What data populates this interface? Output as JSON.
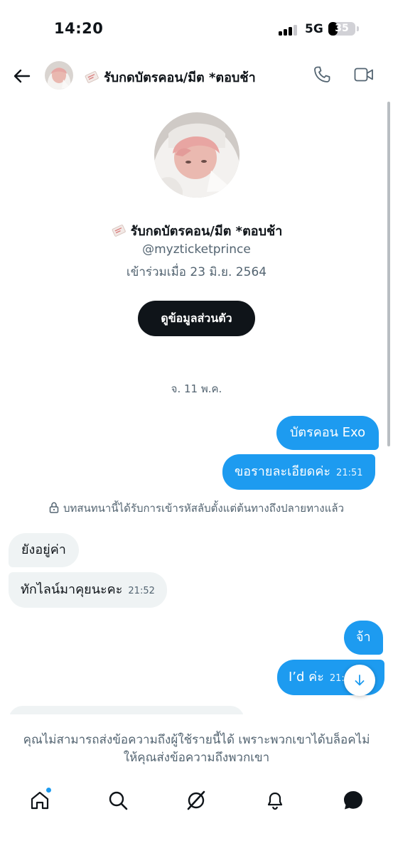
{
  "status_bar": {
    "time": "14:20",
    "network": "5G",
    "battery_percent": "35"
  },
  "header": {
    "title": "รับกดบัตรคอน/มีต *ตอบช้า"
  },
  "profile": {
    "name": "รับกดบัตรคอน/มีต *ตอบช้า",
    "handle": "@myzticketprince",
    "joined": "เข้าร่วมเมื่อ 23 มิ.ย. 2564",
    "view_profile_label": "ดูข้อมูลส่วนตัว"
  },
  "conversation": {
    "date_separator": "จ. 11 พ.ค.",
    "encryption_note": "บทสนทนานี้ได้รับการเข้ารหัสลับตั้งแต่ต้นทางถึงปลายทางแล้ว",
    "messages": [
      {
        "direction": "out",
        "text": "บัตรคอน Exo",
        "time": ""
      },
      {
        "direction": "out",
        "text": "ขอรายละเอียดค่ะ",
        "time": "21:51"
      },
      {
        "direction": "in",
        "text": "ยังอยู่ค่า",
        "time": ""
      },
      {
        "direction": "in",
        "text": "ทักไลน์มาคุยนะคะ",
        "time": "21:52"
      },
      {
        "direction": "out",
        "text": "จ้า",
        "time": ""
      },
      {
        "direction": "out",
        "text": "I’d ค่ะ",
        "time": "21:5"
      }
    ]
  },
  "blocked_notice": "คุณไม่สามารถส่งข้อความถึงผู้ใช้รายนี้ได้ เพราะพวกเขาได้บล็อคไม่ให้คุณส่งข้อความถึงพวกเขา",
  "tab_bar": {
    "tabs": [
      "home-icon",
      "search-icon",
      "grok-icon",
      "bell-icon",
      "messages-icon"
    ],
    "active": "messages"
  },
  "colors": {
    "accent": "#1d9bf0",
    "incoming_bubble": "#eff3f4",
    "secondary_text": "#536471",
    "primary_text": "#0f1419"
  }
}
